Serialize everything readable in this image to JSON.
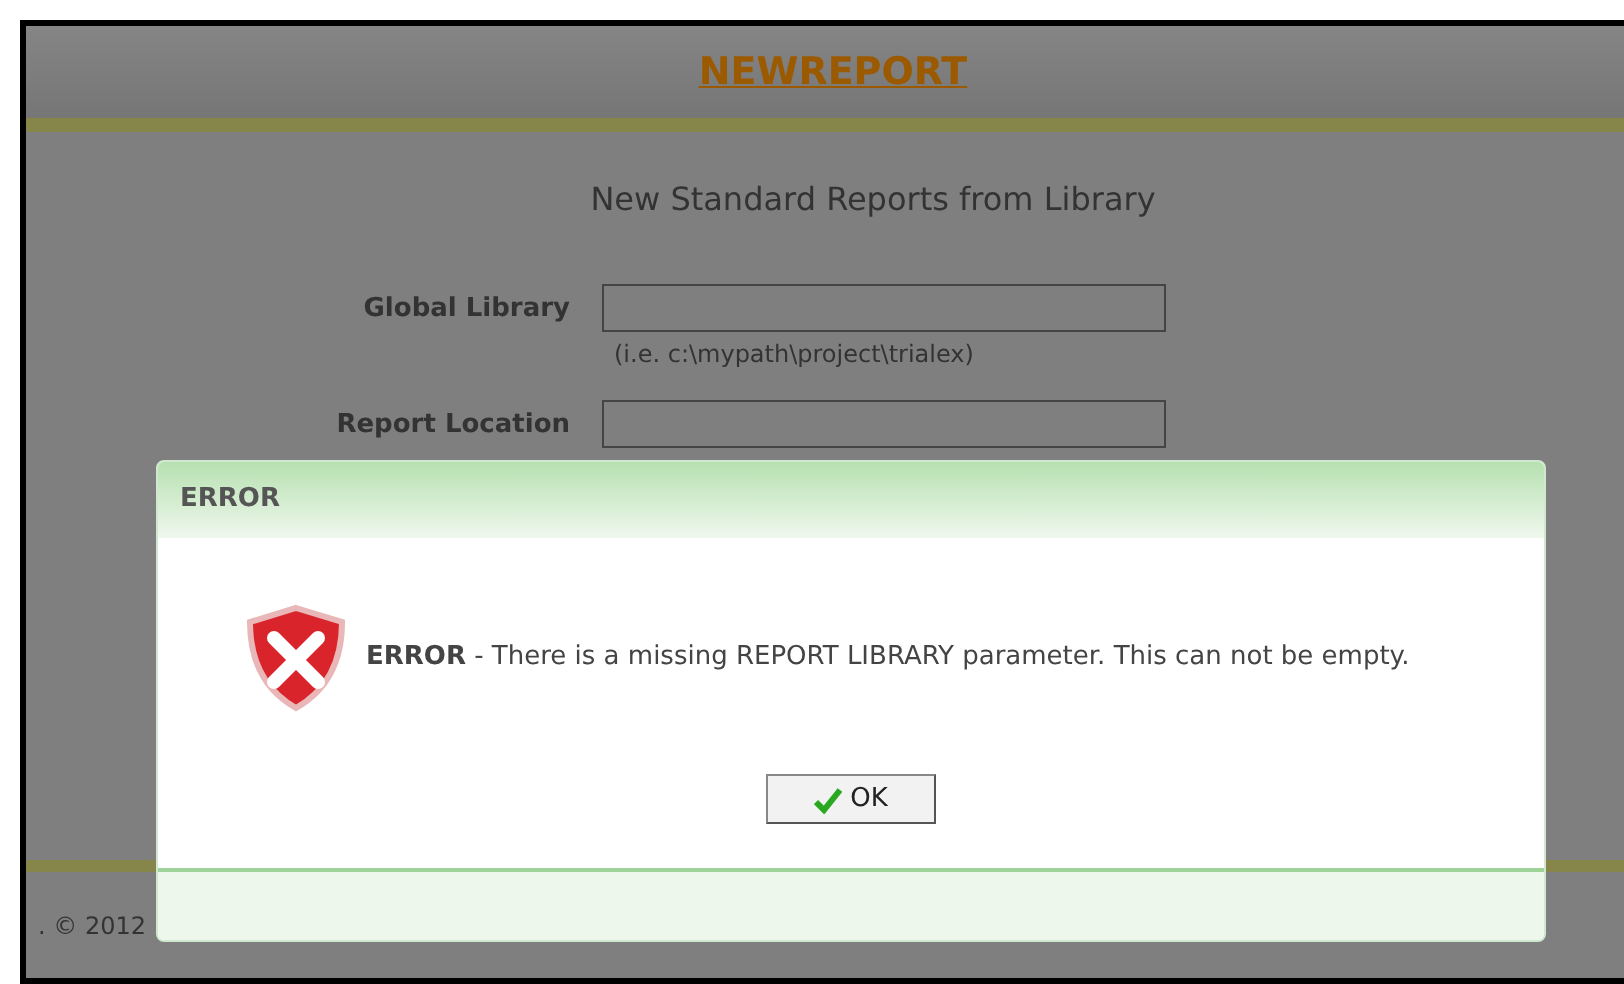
{
  "page": {
    "title": "NEWREPORT",
    "subtitle": "New Standard Reports from Library"
  },
  "fields": [
    {
      "label": "Global Library",
      "hint": "(i.e. c:\\mypath\\project\\trialex)"
    },
    {
      "label": "Report Location"
    }
  ],
  "footer": {
    "text": ". © 2012"
  },
  "dialog": {
    "title": "ERROR",
    "message": "**ERROR** - There is a missing REPORT LIBRARY parameter. This can not be empty.",
    "button": "OK"
  }
}
